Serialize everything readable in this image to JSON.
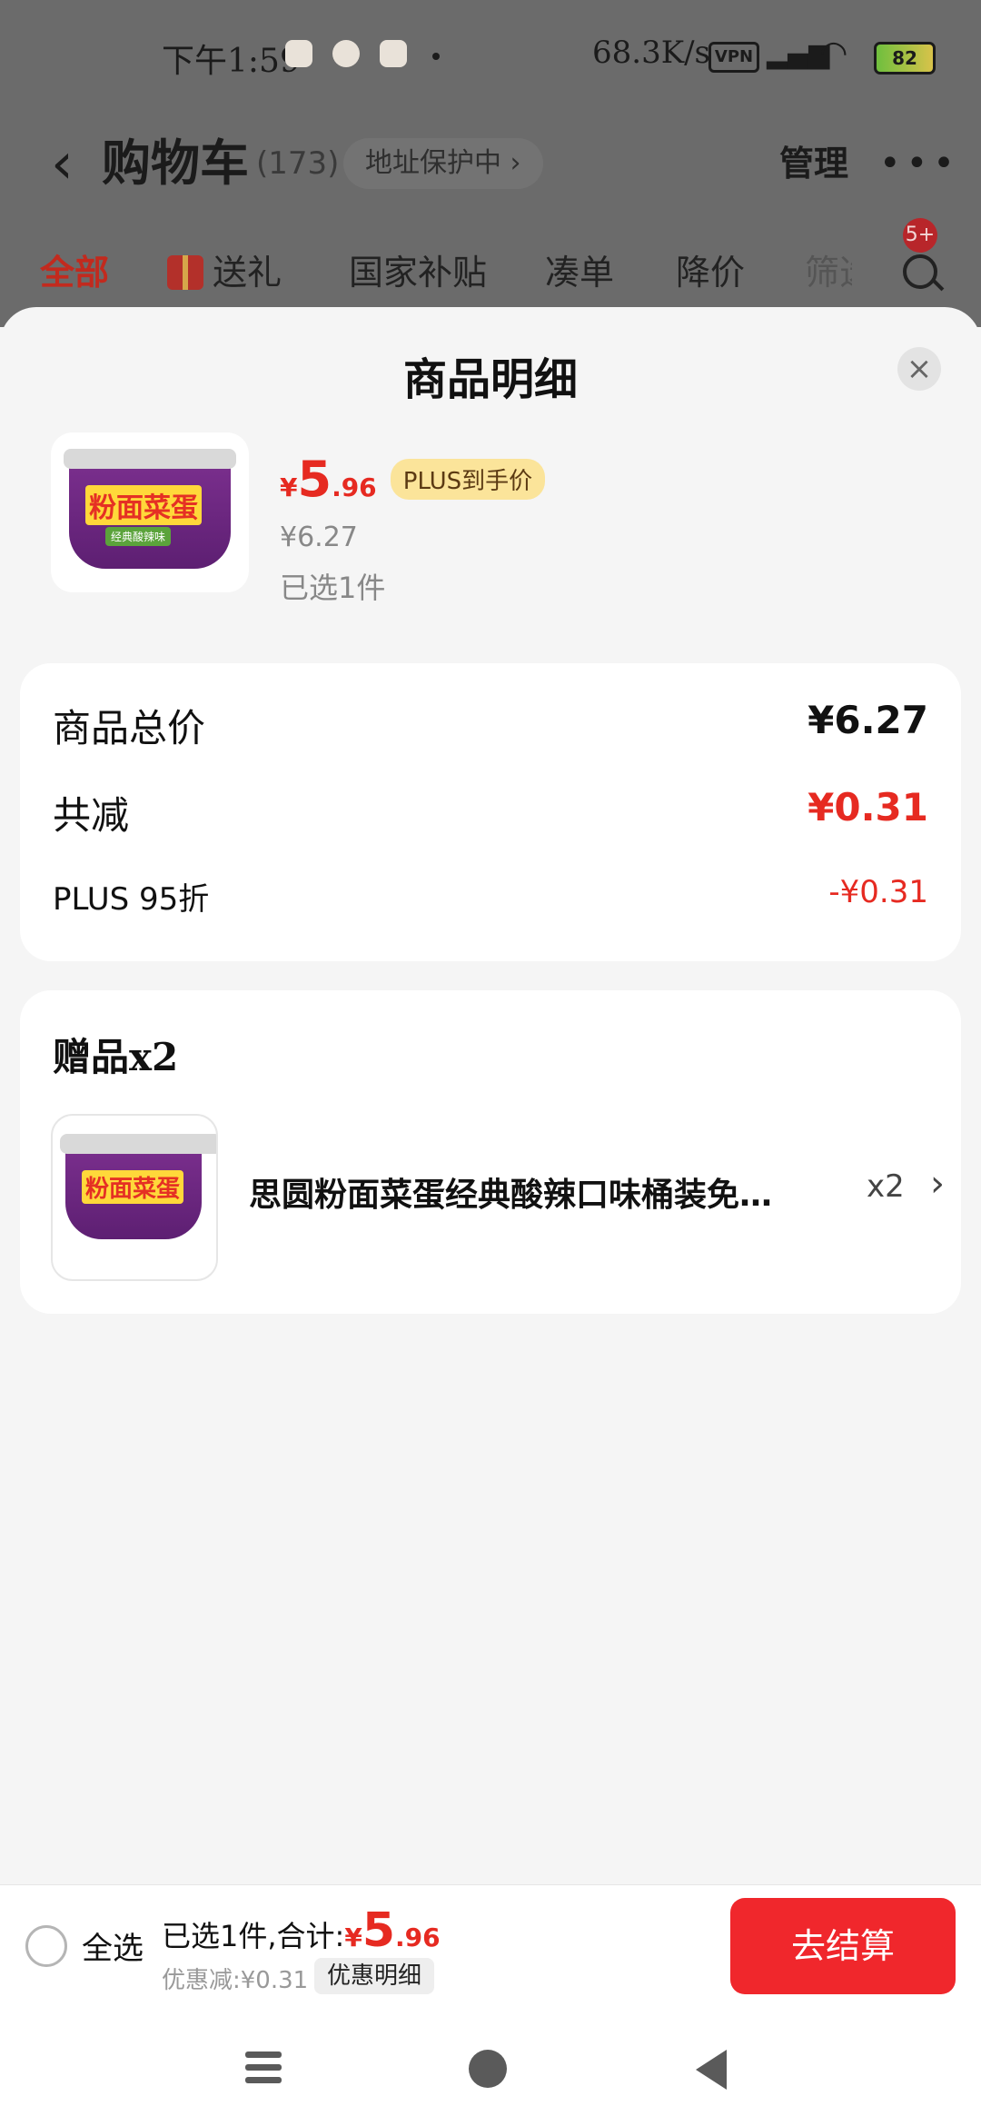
{
  "status_bar": {
    "time": "下午1:59",
    "network_speed": "68.3K/s",
    "vpn": "VPN",
    "signal": "HD",
    "battery": "82"
  },
  "header": {
    "title": "购物车",
    "count": "(173)",
    "address_protect": "地址保护中 ›",
    "manage": "管理",
    "badge": "5+"
  },
  "filter_tabs": [
    "全部",
    "送礼",
    "国家补贴",
    "凑单",
    "降价",
    "筛选"
  ],
  "sheet": {
    "title": "商品明细",
    "product": {
      "price_yen": "¥",
      "price_int": "5",
      "price_dec": ".96",
      "plus_tag": "PLUS到手价",
      "original_price": "¥6.27",
      "selected": "已选1件",
      "image_brand": "粉面菜蛋",
      "image_sub": "经典酸辣味"
    },
    "summary": {
      "total_label": "商品总价",
      "total_value": "¥6.27",
      "reduce_label": "共减",
      "reduce_value": "¥0.31",
      "plus_label": "PLUS 95折",
      "plus_value": "-¥0.31"
    },
    "gifts": {
      "heading": "赠品x2",
      "name": "思圆粉面菜蛋经典酸辣口味桶装免…",
      "qty": "x2"
    }
  },
  "bottom_bar": {
    "select_all": "全选",
    "total_prefix": "已选1件,合计:",
    "total_yen": "¥",
    "total_int": "5",
    "total_dec": ".96",
    "discount": "优惠减:¥0.31",
    "detail_button": "优惠明细",
    "checkout": "去结算"
  },
  "colors": {
    "accent_red": "#e62a21",
    "checkout_red": "#f0272c",
    "plus_tag_bg": "#fbe49a"
  }
}
